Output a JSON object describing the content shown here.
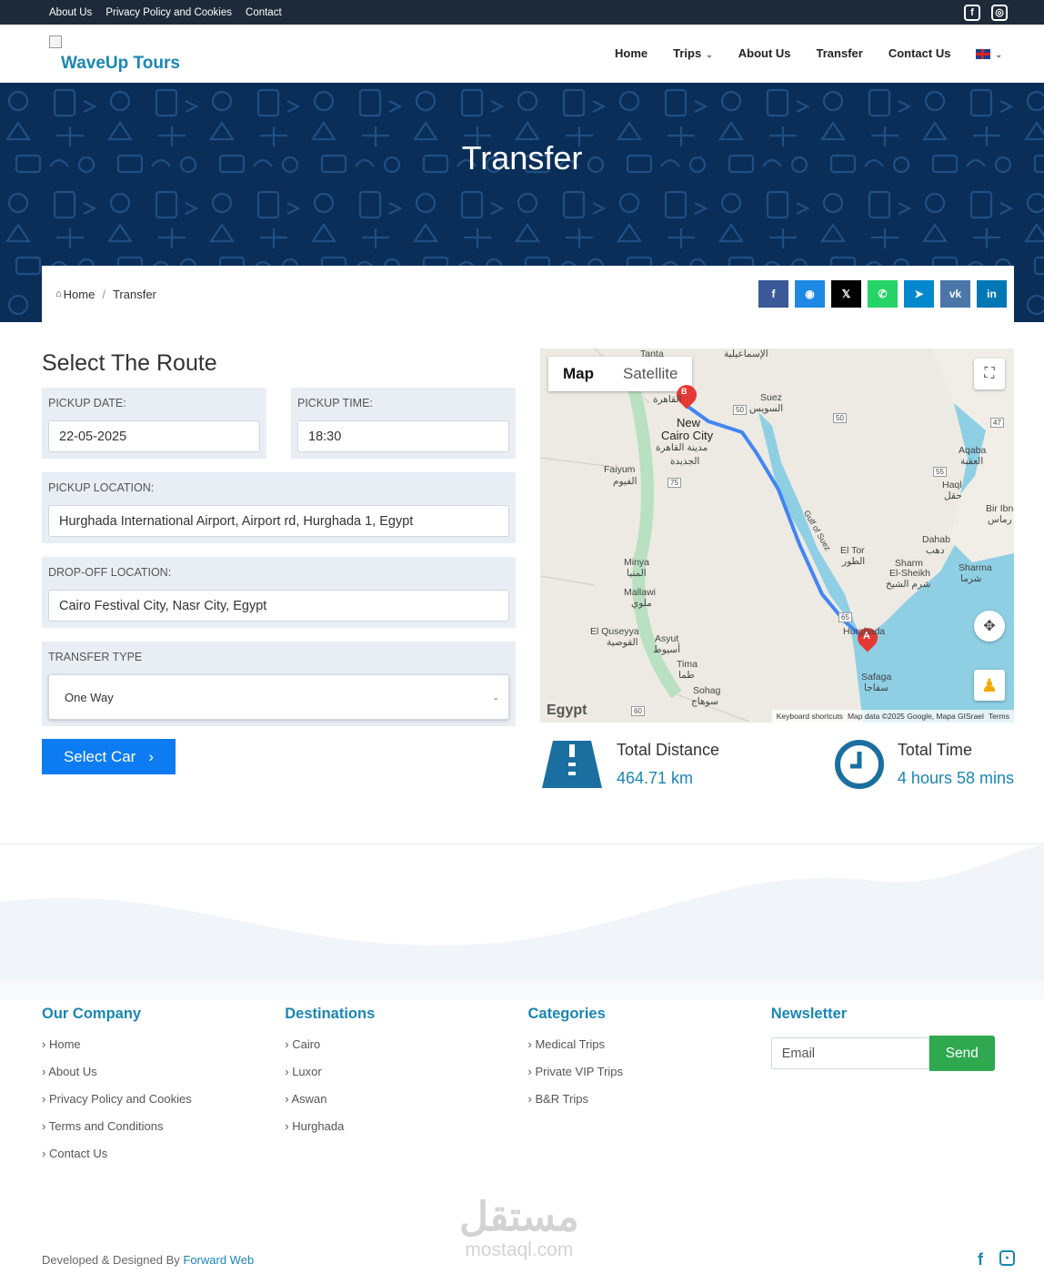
{
  "topbar": {
    "links": [
      "About Us",
      "Privacy Policy and Cookies",
      "Contact"
    ],
    "icons": [
      "facebook-icon",
      "instagram-icon"
    ]
  },
  "header": {
    "brand": "WaveUp Tours",
    "nav": [
      {
        "label": "Home",
        "caret": false
      },
      {
        "label": "Trips",
        "caret": true
      },
      {
        "label": "About Us",
        "caret": false
      },
      {
        "label": "Transfer",
        "caret": false,
        "active": true
      },
      {
        "label": "Contact Us",
        "caret": false
      }
    ],
    "language_icon": "uk-flag-icon"
  },
  "hero": {
    "title": "Transfer"
  },
  "breadcrumb": {
    "home": "Home",
    "separator": "/",
    "current": "Transfer"
  },
  "share_buttons": [
    {
      "name": "facebook",
      "glyph": "f",
      "color": "#3b5998"
    },
    {
      "name": "messenger",
      "glyph": "◉",
      "color": "#1e88e5"
    },
    {
      "name": "x",
      "glyph": "𝕏",
      "color": "#000000"
    },
    {
      "name": "whatsapp",
      "glyph": "✆",
      "color": "#25d366"
    },
    {
      "name": "telegram",
      "glyph": "➤",
      "color": "#0088cc"
    },
    {
      "name": "vk",
      "glyph": "vk",
      "color": "#4a76a8"
    },
    {
      "name": "linkedin",
      "glyph": "in",
      "color": "#0077b5"
    }
  ],
  "route": {
    "title": "Select The Route",
    "pickup_date_label": "PICKUP DATE:",
    "pickup_date": "22-05-2025",
    "pickup_time_label": "PICKUP TIME:",
    "pickup_time": "18:30",
    "pickup_location_label": "PICKUP LOCATION:",
    "pickup_location": "Hurghada International Airport, Airport rd, Hurghada 1, Egypt",
    "dropoff_location_label": "DROP-OFF LOCATION:",
    "dropoff_location": "Cairo Festival City, Nasr City, Egypt",
    "transfer_type_label": "TRANSFER TYPE",
    "transfer_type": "One Way",
    "select_car_label": "Select Car"
  },
  "map": {
    "tab_map": "Map",
    "tab_satellite": "Satellite",
    "logo": "Egypt",
    "attribution": [
      "Keyboard shortcuts",
      "Map data ©2025 Google, Mapa GISrael",
      "Terms"
    ],
    "marker_a": "A",
    "marker_b": "B",
    "places": {
      "tanta": "Tanta",
      "ismailia": "الإسماعيلية",
      "suez": "Suez",
      "suez_ar": "السويس",
      "cairo": "القاهرة",
      "new_cairo": "New",
      "new_cairo2": "Cairo City",
      "new_cairo_ar": "مدينة القاهرة",
      "new_cairo_ar2": "الجديدة",
      "faiyum": "Faiyum",
      "faiyum_ar": "الفيوم",
      "aqaba": "Aqaba",
      "aqaba_ar": "العقبة",
      "haql": "Haql",
      "haql_ar": "حقل",
      "bir_ibn": "Bir Ibn",
      "bir_ibn_ar": "رماس",
      "gulf": "Gulf of Suez",
      "el_tor": "El Tor",
      "el_tor_ar": "الطور",
      "dahab": "Dahab",
      "dahab_ar": "دهب",
      "sharm": "Sharm",
      "sharm2": "El-Sheikh",
      "sharm_ar": "شرم الشيخ",
      "sharma": "Sharma",
      "sharma_ar": "شرما",
      "minya": "Minya",
      "minya_ar": "المنيا",
      "mallawi": "Mallawi",
      "mallawi_ar": "ملوي",
      "quseyya": "El Quseyya",
      "quseyya_ar": "القوصية",
      "asyut": "Asyut",
      "asyut_ar": "أسيوط",
      "hurghada": "Hurghada",
      "tima": "Tima",
      "tima_ar": "طما",
      "sohag": "Sohag",
      "sohag_ar": "سوهاج",
      "safaga": "Safaga",
      "safaga_ar": "سفاجا"
    },
    "road_labels": [
      "50",
      "50",
      "47",
      "55",
      "75",
      "65",
      "60"
    ]
  },
  "stats": {
    "distance_label": "Total Distance",
    "distance_value": "464.71 km",
    "time_label": "Total Time",
    "time_value": "4 hours 58 mins"
  },
  "footer": {
    "columns": [
      {
        "title": "Our Company",
        "links": [
          "Home",
          "About Us",
          "Privacy Policy and Cookies",
          "Terms and Conditions",
          "Contact Us"
        ]
      },
      {
        "title": "Destinations",
        "links": [
          "Cairo",
          "Luxor",
          "Aswan",
          "Hurghada"
        ]
      },
      {
        "title": "Categories",
        "links": [
          "Medical Trips",
          "Private VIP Trips",
          "B&R Trips"
        ]
      }
    ],
    "newsletter_title": "Newsletter",
    "email_placeholder": "Email",
    "send_label": "Send",
    "credit_prefix": "Developed & Designed By",
    "credit_link": "Forward Web",
    "watermark_ar": "مستقل",
    "watermark_en": "mostaql.com"
  },
  "colors": {
    "accent": "#1b86b3",
    "topbar": "#1e2a3a",
    "hero": "#0a2e57",
    "button": "#0d7cf2",
    "send": "#2fa84f"
  }
}
